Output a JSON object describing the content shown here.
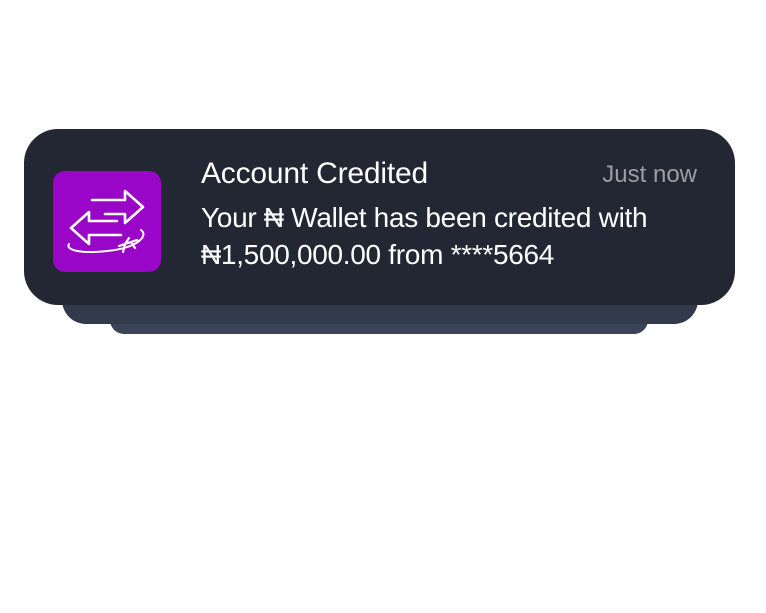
{
  "notification": {
    "title": "Account Credited",
    "timestamp": "Just now",
    "message": "Your ₦ Wallet has been credited with ₦1,500,000.00 from ****5664",
    "app_icon": "exchange-arrows-plane-icon",
    "colors": {
      "card_background": "#232733",
      "icon_background": "#9a06c8",
      "title_text": "#ffffff",
      "timestamp_text": "#9a9da6",
      "stack_layer_1": "#323a4c",
      "stack_layer_2": "#3b4356"
    }
  }
}
